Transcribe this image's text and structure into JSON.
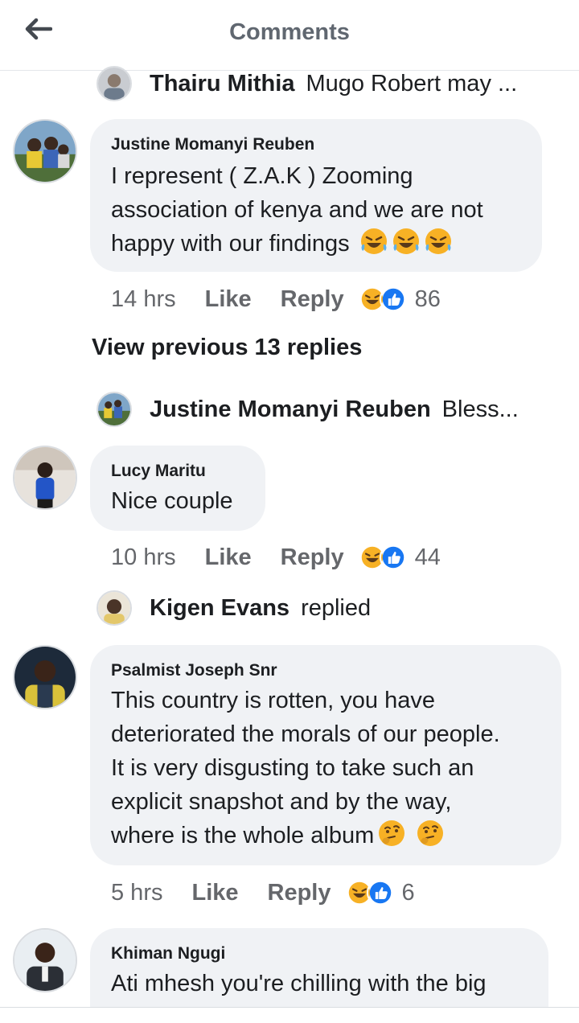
{
  "header": {
    "title": "Comments",
    "back_icon": "arrow-left-icon"
  },
  "colors": {
    "bubble": "#f0f2f5",
    "like_blue": "#1877f2",
    "haha_yellow": "#f7b125",
    "muted": "#65676b"
  },
  "top_reply": {
    "name": "Thairu Mithia",
    "snippet": "Mugo Robert may ..."
  },
  "comments": [
    {
      "author": "Justine Momanyi Reuben",
      "lines": [
        "I represent ( Z.A.K ) Zooming",
        "association of kenya and we are not",
        "happy with our findings"
      ],
      "emojis": [
        "rofl",
        "rofl",
        "rofl"
      ],
      "time": "14 hrs",
      "like": "Like",
      "reply": "Reply",
      "reaction_count": "86"
    },
    {
      "author": "Lucy Maritu",
      "lines": [
        "Nice couple"
      ],
      "time": "10 hrs",
      "like": "Like",
      "reply": "Reply",
      "reaction_count": "44"
    },
    {
      "author": "Psalmist Joseph Snr",
      "lines": [
        "This country is rotten, you have",
        "deteriorated the morals of our people.",
        "It is very disgusting to take such an",
        "explicit snapshot and by the way,",
        "where is the whole album"
      ],
      "emojis": [
        "thinking",
        "thinking"
      ],
      "time": "5 hrs",
      "like": "Like",
      "reply": "Reply",
      "reaction_count": "6"
    },
    {
      "author": "Khiman Ngugi",
      "lines": [
        "Ati mhesh you're chilling with the big"
      ]
    }
  ],
  "view_previous": "View previous 13 replies",
  "reply_lines": [
    {
      "name": "Justine Momanyi Reuben",
      "snippet": "Bless..."
    },
    {
      "name": "Kigen Evans",
      "snippet": "replied"
    }
  ]
}
